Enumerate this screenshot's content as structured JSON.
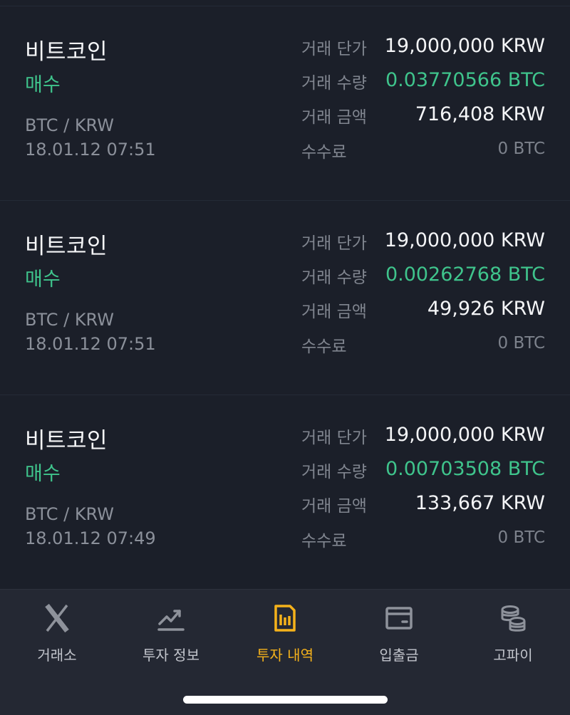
{
  "trades": [
    {
      "coin": "비트코인",
      "type": "매수",
      "pair": "BTC / KRW",
      "time": "18.01.12 07:51",
      "price_label": "거래 단가",
      "price": "19,000,000 KRW",
      "qty_label": "거래 수량",
      "qty": "0.03770566 BTC",
      "amount_label": "거래 금액",
      "amount": "716,408 KRW",
      "fee_label": "수수료",
      "fee": "0 BTC"
    },
    {
      "coin": "비트코인",
      "type": "매수",
      "pair": "BTC / KRW",
      "time": "18.01.12 07:51",
      "price_label": "거래 단가",
      "price": "19,000,000 KRW",
      "qty_label": "거래 수량",
      "qty": "0.00262768 BTC",
      "amount_label": "거래 금액",
      "amount": "49,926 KRW",
      "fee_label": "수수료",
      "fee": "0 BTC"
    },
    {
      "coin": "비트코인",
      "type": "매수",
      "pair": "BTC / KRW",
      "time": "18.01.12 07:49",
      "price_label": "거래 단가",
      "price": "19,000,000 KRW",
      "qty_label": "거래 수량",
      "qty": "0.00703508 BTC",
      "amount_label": "거래 금액",
      "amount": "133,667 KRW",
      "fee_label": "수수료",
      "fee": "0 BTC"
    }
  ],
  "nav": {
    "items": [
      {
        "label": "거래소",
        "icon": "exchange-x-icon"
      },
      {
        "label": "투자 정보",
        "icon": "trend-chart-icon"
      },
      {
        "label": "투자 내역",
        "icon": "history-list-icon"
      },
      {
        "label": "입출금",
        "icon": "wallet-icon"
      },
      {
        "label": "고파이",
        "icon": "coins-stack-icon"
      }
    ],
    "active_index": 2
  },
  "colors": {
    "background": "#1b1f29",
    "buy_green": "#3fc48c",
    "active_yellow": "#f5b21b",
    "nav_background": "#242833"
  }
}
